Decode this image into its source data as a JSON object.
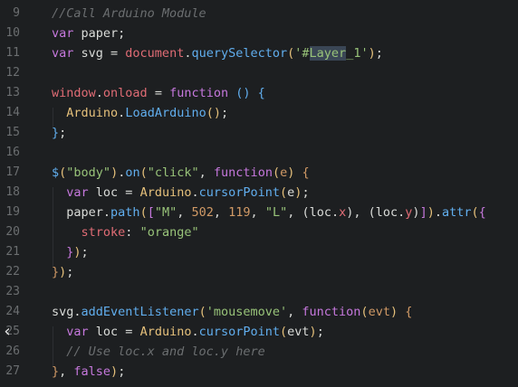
{
  "lines": [
    {
      "num": "9",
      "tokens": [
        {
          "t": "//Call Arduino Module",
          "c": "comment"
        }
      ]
    },
    {
      "num": "10",
      "tokens": [
        {
          "t": "var",
          "c": "keyword"
        },
        {
          "t": " paper;",
          "c": "plain"
        }
      ]
    },
    {
      "num": "11",
      "tokens": [
        {
          "t": "var",
          "c": "keyword"
        },
        {
          "t": " svg = ",
          "c": "plain"
        },
        {
          "t": "document",
          "c": "red"
        },
        {
          "t": ".",
          "c": "plain"
        },
        {
          "t": "querySelector",
          "c": "prop"
        },
        {
          "t": "(",
          "c": "paren"
        },
        {
          "t": "'#",
          "c": "string"
        },
        {
          "t": "Layer",
          "c": "string",
          "sel": true
        },
        {
          "t": "_1'",
          "c": "string"
        },
        {
          "t": ")",
          "c": "paren"
        },
        {
          "t": ";",
          "c": "plain"
        }
      ]
    },
    {
      "num": "12",
      "tokens": []
    },
    {
      "num": "13",
      "tokens": [
        {
          "t": "window",
          "c": "red"
        },
        {
          "t": ".",
          "c": "plain"
        },
        {
          "t": "onload",
          "c": "red"
        },
        {
          "t": " = ",
          "c": "plain"
        },
        {
          "t": "function",
          "c": "keyword"
        },
        {
          "t": " () ",
          "c": "prop"
        },
        {
          "t": "{",
          "c": "prop"
        }
      ]
    },
    {
      "num": "14",
      "tokens": [
        {
          "t": "  ",
          "c": "plain"
        },
        {
          "t": "Arduino",
          "c": "class"
        },
        {
          "t": ".",
          "c": "plain"
        },
        {
          "t": "LoadArduino",
          "c": "prop"
        },
        {
          "t": "()",
          "c": "paren"
        },
        {
          "t": ";",
          "c": "plain"
        }
      ]
    },
    {
      "num": "15",
      "tokens": [
        {
          "t": "}",
          "c": "prop"
        },
        {
          "t": ";",
          "c": "plain"
        }
      ]
    },
    {
      "num": "16",
      "tokens": []
    },
    {
      "num": "17",
      "tokens": [
        {
          "t": "$",
          "c": "prop"
        },
        {
          "t": "(",
          "c": "paren"
        },
        {
          "t": "\"body\"",
          "c": "string"
        },
        {
          "t": ")",
          "c": "paren"
        },
        {
          "t": ".",
          "c": "plain"
        },
        {
          "t": "on",
          "c": "prop"
        },
        {
          "t": "(",
          "c": "paren"
        },
        {
          "t": "\"click\"",
          "c": "string"
        },
        {
          "t": ", ",
          "c": "plain"
        },
        {
          "t": "function",
          "c": "keyword"
        },
        {
          "t": "(",
          "c": "paren"
        },
        {
          "t": "e",
          "c": "number"
        },
        {
          "t": ")",
          "c": "paren"
        },
        {
          "t": " {",
          "c": "brace"
        }
      ]
    },
    {
      "num": "18",
      "tokens": [
        {
          "t": "  ",
          "c": "plain"
        },
        {
          "t": "var",
          "c": "keyword"
        },
        {
          "t": " loc = ",
          "c": "plain"
        },
        {
          "t": "Arduino",
          "c": "class"
        },
        {
          "t": ".",
          "c": "plain"
        },
        {
          "t": "cursorPoint",
          "c": "prop"
        },
        {
          "t": "(",
          "c": "paren"
        },
        {
          "t": "e",
          "c": "plain"
        },
        {
          "t": ")",
          "c": "paren"
        },
        {
          "t": ";",
          "c": "plain"
        }
      ]
    },
    {
      "num": "19",
      "tokens": [
        {
          "t": "  paper",
          "c": "plain"
        },
        {
          "t": ".",
          "c": "plain"
        },
        {
          "t": "path",
          "c": "prop"
        },
        {
          "t": "(",
          "c": "paren"
        },
        {
          "t": "[",
          "c": "bracket"
        },
        {
          "t": "\"M\"",
          "c": "string"
        },
        {
          "t": ", ",
          "c": "plain"
        },
        {
          "t": "502",
          "c": "number"
        },
        {
          "t": ", ",
          "c": "plain"
        },
        {
          "t": "119",
          "c": "number"
        },
        {
          "t": ", ",
          "c": "plain"
        },
        {
          "t": "\"L\"",
          "c": "string"
        },
        {
          "t": ", (loc.",
          "c": "plain"
        },
        {
          "t": "x",
          "c": "red"
        },
        {
          "t": "), (loc.",
          "c": "plain"
        },
        {
          "t": "y",
          "c": "red"
        },
        {
          "t": ")",
          "c": "plain"
        },
        {
          "t": "]",
          "c": "bracket"
        },
        {
          "t": ")",
          "c": "paren"
        },
        {
          "t": ".",
          "c": "plain"
        },
        {
          "t": "attr",
          "c": "prop"
        },
        {
          "t": "(",
          "c": "paren"
        },
        {
          "t": "{",
          "c": "bracket"
        }
      ]
    },
    {
      "num": "20",
      "tokens": [
        {
          "t": "    ",
          "c": "plain"
        },
        {
          "t": "stroke",
          "c": "red"
        },
        {
          "t": ": ",
          "c": "plain"
        },
        {
          "t": "\"orange\"",
          "c": "string"
        }
      ]
    },
    {
      "num": "21",
      "tokens": [
        {
          "t": "  ",
          "c": "plain"
        },
        {
          "t": "}",
          "c": "bracket"
        },
        {
          "t": ")",
          "c": "paren"
        },
        {
          "t": ";",
          "c": "plain"
        }
      ]
    },
    {
      "num": "22",
      "tokens": [
        {
          "t": "}",
          "c": "brace"
        },
        {
          "t": ")",
          "c": "paren"
        },
        {
          "t": ";",
          "c": "plain"
        }
      ]
    },
    {
      "num": "23",
      "tokens": []
    },
    {
      "num": "24",
      "tokens": [
        {
          "t": "svg",
          "c": "plain"
        },
        {
          "t": ".",
          "c": "plain"
        },
        {
          "t": "addEventListener",
          "c": "prop"
        },
        {
          "t": "(",
          "c": "paren"
        },
        {
          "t": "'mousemove'",
          "c": "string"
        },
        {
          "t": ", ",
          "c": "plain"
        },
        {
          "t": "function",
          "c": "keyword"
        },
        {
          "t": "(",
          "c": "paren"
        },
        {
          "t": "evt",
          "c": "number"
        },
        {
          "t": ")",
          "c": "paren"
        },
        {
          "t": " {",
          "c": "brace"
        }
      ]
    },
    {
      "num": "25",
      "tokens": [
        {
          "t": "  ",
          "c": "plain"
        },
        {
          "t": "var",
          "c": "keyword"
        },
        {
          "t": " loc = ",
          "c": "plain"
        },
        {
          "t": "Arduino",
          "c": "class"
        },
        {
          "t": ".",
          "c": "plain"
        },
        {
          "t": "cursorPoint",
          "c": "prop"
        },
        {
          "t": "(",
          "c": "paren"
        },
        {
          "t": "evt",
          "c": "plain"
        },
        {
          "t": ")",
          "c": "paren"
        },
        {
          "t": ";",
          "c": "plain"
        }
      ]
    },
    {
      "num": "26",
      "tokens": [
        {
          "t": "  // Use loc.x and loc.y here",
          "c": "comment"
        }
      ]
    },
    {
      "num": "27",
      "tokens": [
        {
          "t": "}",
          "c": "brace"
        },
        {
          "t": ", ",
          "c": "plain"
        },
        {
          "t": "false",
          "c": "keyword"
        },
        {
          "t": ")",
          "c": "paren"
        },
        {
          "t": ";",
          "c": "plain"
        }
      ]
    }
  ],
  "fold_arrow_icon": "chevron-left-icon"
}
